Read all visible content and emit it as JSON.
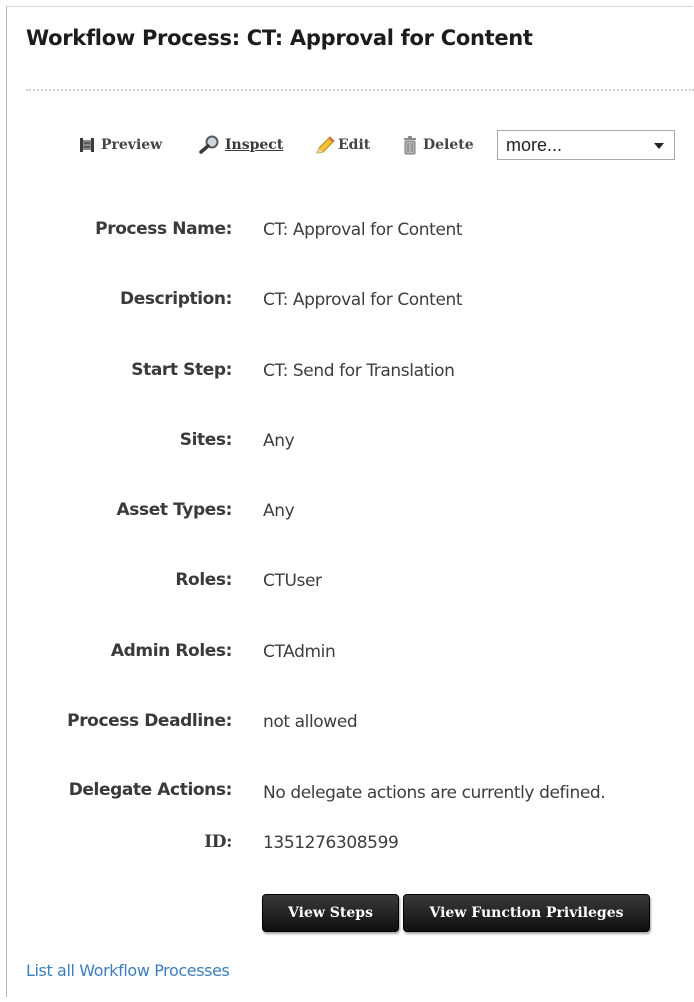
{
  "header": {
    "title": "Workflow Process: CT: Approval for Content"
  },
  "toolbar": {
    "preview_label": "Preview",
    "inspect_label": "Inspect",
    "edit_label": "Edit",
    "delete_label": "Delete",
    "more_select": {
      "selected": "more..."
    },
    "icons": {
      "preview": "preview-icon",
      "inspect": "magnifier-icon",
      "edit": "pencil-icon",
      "delete": "trash-icon"
    }
  },
  "details": {
    "process_name": {
      "label": "Process Name:",
      "value": "CT: Approval for Content"
    },
    "description": {
      "label": "Description:",
      "value": "CT: Approval for Content"
    },
    "start_step": {
      "label": "Start Step:",
      "value": "CT: Send for Translation"
    },
    "sites": {
      "label": "Sites:",
      "value": "Any"
    },
    "asset_types": {
      "label": "Asset Types:",
      "value": "Any"
    },
    "roles": {
      "label": "Roles:",
      "value": "CTUser"
    },
    "admin_roles": {
      "label": "Admin Roles:",
      "value": "CTAdmin"
    },
    "process_deadline": {
      "label": "Process Deadline:",
      "value": "not allowed"
    },
    "delegate_actions": {
      "label": "Delegate Actions:",
      "value": "No delegate actions are currently defined."
    },
    "id": {
      "label": "ID:",
      "value": "1351276308599"
    }
  },
  "buttons": {
    "view_steps": "View Steps",
    "view_function_privileges": "View Function Privileges"
  },
  "footer": {
    "list_link": "List all Workflow Processes"
  },
  "colors": {
    "link": "#3a7fbf",
    "button_bg": "#1a1a1a",
    "text": "#333333"
  }
}
